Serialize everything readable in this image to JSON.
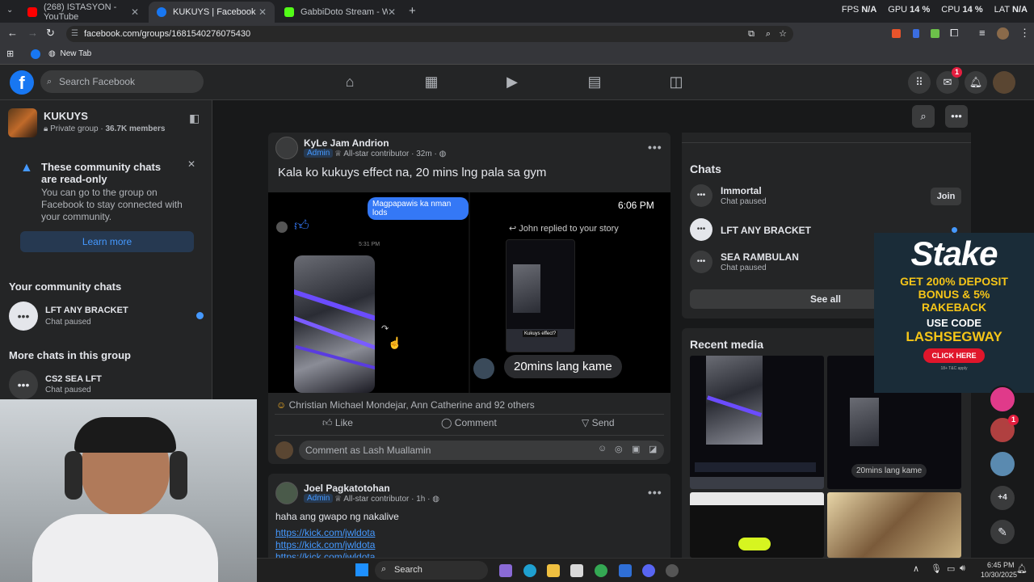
{
  "browser": {
    "tabs": [
      {
        "title": "(268) ISTASYON - YouTube",
        "active": false,
        "color": "#ff0000"
      },
      {
        "title": "KUKUYS | Facebook",
        "active": true,
        "color": "#1877f2"
      },
      {
        "title": "GabbiDoto Stream - Watch Liv",
        "active": false,
        "color": "#53fc18"
      }
    ],
    "new_tab": "+",
    "stats": {
      "fps_label": "FPS",
      "fps_value": "N/A",
      "gpu_label": "GPU",
      "gpu_value": "14 %",
      "cpu_label": "CPU",
      "cpu_value": "14 %",
      "lat_label": "LAT",
      "lat_value": "N/A"
    },
    "url": "facebook.com/groups/1681540276075430",
    "bookmark": "New Tab"
  },
  "fb": {
    "logo": "f",
    "search_placeholder": "Search Facebook",
    "messenger_badge": "1"
  },
  "group": {
    "name": "KUKUYS",
    "privacy": "Private group",
    "members": "36.7K members"
  },
  "notice": {
    "title": "These community chats are read-only",
    "body": "You can go to the group on Facebook to stay connected with your community.",
    "button": "Learn more"
  },
  "your_chats": {
    "heading": "Your community chats",
    "items": [
      {
        "name": "LFT ANY BRACKET",
        "status": "Chat paused"
      }
    ]
  },
  "more_chats": {
    "heading": "More chats in this group",
    "items": [
      {
        "name": "CS2 SEA LFT",
        "status": "Chat paused"
      }
    ]
  },
  "post1": {
    "author": "KyLe Jam Andrion",
    "role": "Admin",
    "badge": "All-star contributor",
    "time": "32m",
    "text": "Kala ko kukuys effect na, 20 mins lng pala sa gym",
    "media_left_bubble": "Magpapawis ka nman lods",
    "media_left_time": "5:31 PM",
    "media_right_time": "6:06 PM",
    "media_right_reply": "John replied to your story",
    "media_right_caption": "20mins lang kame",
    "media_story_note": "Kukuys effect?",
    "reactions": "Christian Michael Mondejar, Ann Catherine and 92 others",
    "like": "Like",
    "comment": "Comment",
    "send": "Send",
    "comment_placeholder": "Comment as Lash Muallamin"
  },
  "post2": {
    "author": "Joel Pagkatotohan",
    "role": "Admin",
    "badge": "All-star contributor",
    "time": "1h",
    "text": "haha ang gwapo ng nakalive",
    "links": [
      "https://kick.com/jwldota",
      "https://kick.com/jwldota",
      "https://kick.com/jwldota"
    ]
  },
  "chats_panel": {
    "heading": "Chats",
    "items": [
      {
        "name": "Immortal",
        "status": "Chat paused",
        "action": "Join"
      },
      {
        "name": "LFT ANY BRACKET",
        "status": ""
      },
      {
        "name": "SEA RAMBULAN",
        "status": "Chat paused"
      }
    ],
    "see_all": "See all"
  },
  "recent_media": {
    "heading": "Recent media",
    "caption": "20mins lang kame"
  },
  "ad": {
    "brand": "Stake",
    "line1": "GET 200% DEPOSIT",
    "line2": "BONUS & 5%",
    "line3": "RAKEBACK",
    "line4": "USE CODE",
    "code": "LASHSEGWAY",
    "cta": "CLICK HERE",
    "fine": "18+ T&C apply"
  },
  "contacts": {
    "badge": "1",
    "more": "+4"
  },
  "taskbar": {
    "search": "Search",
    "time": "6:45 PM",
    "date": "10/30/2025"
  }
}
